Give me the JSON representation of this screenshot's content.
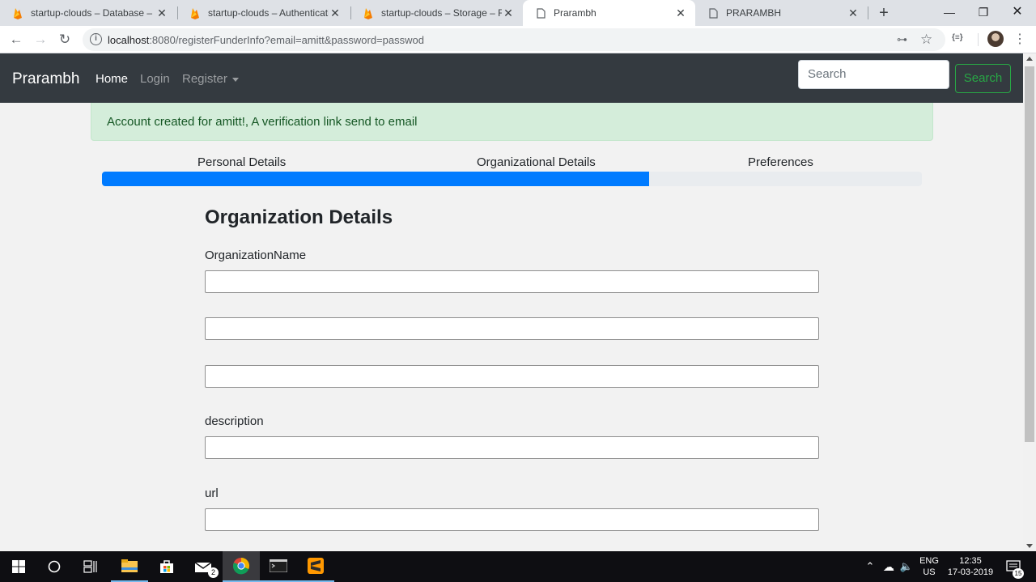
{
  "browser": {
    "tabs": [
      {
        "title": "startup-clouds – Database – Fi",
        "icon": "firebase-icon"
      },
      {
        "title": "startup-clouds – Authenticatio",
        "icon": "firebase-icon"
      },
      {
        "title": "startup-clouds – Storage – Fire",
        "icon": "firebase-icon"
      },
      {
        "title": "Prarambh",
        "icon": "page-icon"
      },
      {
        "title": "PRARAMBH",
        "icon": "page-icon"
      }
    ],
    "url_host": "localhost",
    "url_rest": ":8080/registerFunderInfo?email=amitt&password=passwod",
    "extension_label": "{≡}"
  },
  "navbar": {
    "brand": "Prarambh",
    "links": [
      "Home",
      "Login",
      "Register"
    ],
    "search_placeholder": "Search",
    "search_button": "Search"
  },
  "alert": {
    "message": "Account created for amitt!, A verification link send to email"
  },
  "steps": {
    "labels": [
      "Personal Details",
      "Organizational Details",
      "Preferences"
    ],
    "progress_percent": 66.7,
    "progress_color": "#007bff"
  },
  "form": {
    "title": "Organization Details",
    "fields": [
      {
        "label": "OrganizationName",
        "value": ""
      },
      {
        "label": "",
        "value": ""
      },
      {
        "label": "",
        "value": ""
      },
      {
        "label": "description",
        "value": ""
      },
      {
        "label": "url",
        "value": ""
      }
    ]
  },
  "taskbar": {
    "mail_badge": "2",
    "language": "ENG",
    "region": "US",
    "time": "12:35",
    "date": "17-03-2019",
    "notification_count": "15"
  }
}
